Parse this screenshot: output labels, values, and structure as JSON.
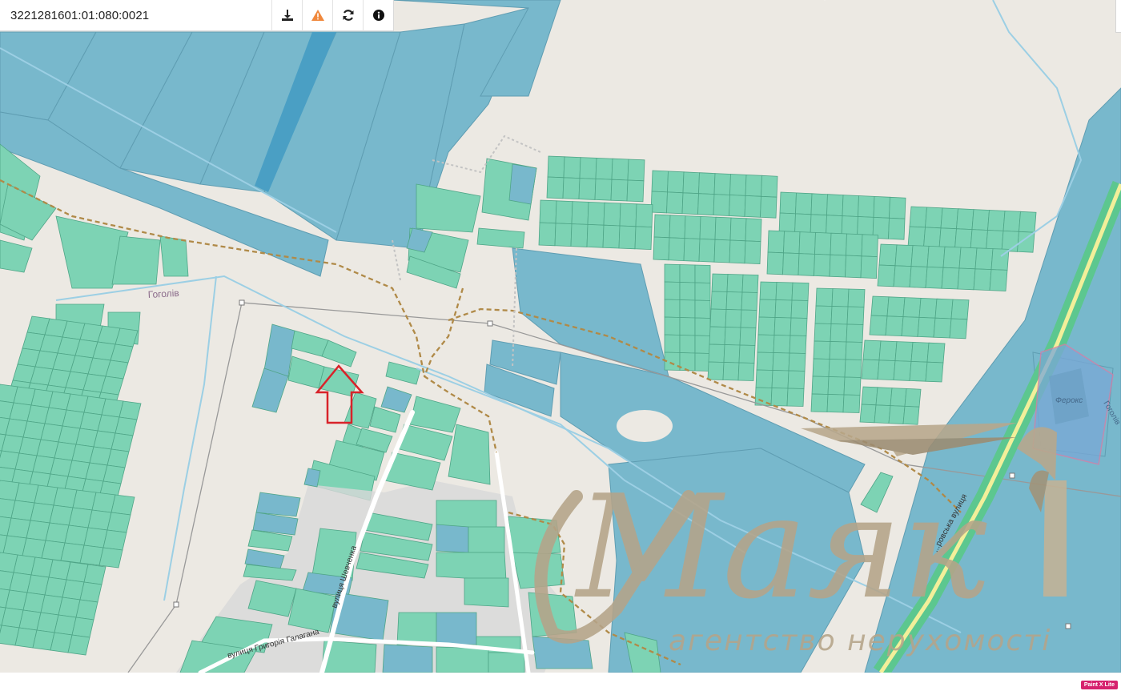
{
  "toolbar": {
    "cadastral_number": "3221281601:01:080:0021",
    "buttons": [
      {
        "name": "download-button",
        "icon": "download-icon"
      },
      {
        "name": "report-button",
        "icon": "warning-icon"
      },
      {
        "name": "refresh-button",
        "icon": "refresh-icon"
      },
      {
        "name": "info-button",
        "icon": "info-icon"
      }
    ]
  },
  "map": {
    "labels": {
      "village": "Гоголів",
      "street_shevchenka": "вулиця Шевченка",
      "street_halahana": "вулиця Григорія Галагана",
      "street_east": "...ровська вулиця",
      "ferocs": "Ферокс",
      "edge_right": "Гоголів"
    },
    "colors": {
      "background": "#ece9e3",
      "parcel_blue": "#78b8cc",
      "parcel_green": "#7dd3b4",
      "parcel_dark_blue": "#4a9fc4",
      "boundary_dashed": "#b08a48",
      "marker": "#d8232a"
    }
  },
  "watermark": {
    "logo_text": "Маяк",
    "tagline": "агентство нерухомості"
  },
  "badge": {
    "text": "Paint X Lite"
  }
}
